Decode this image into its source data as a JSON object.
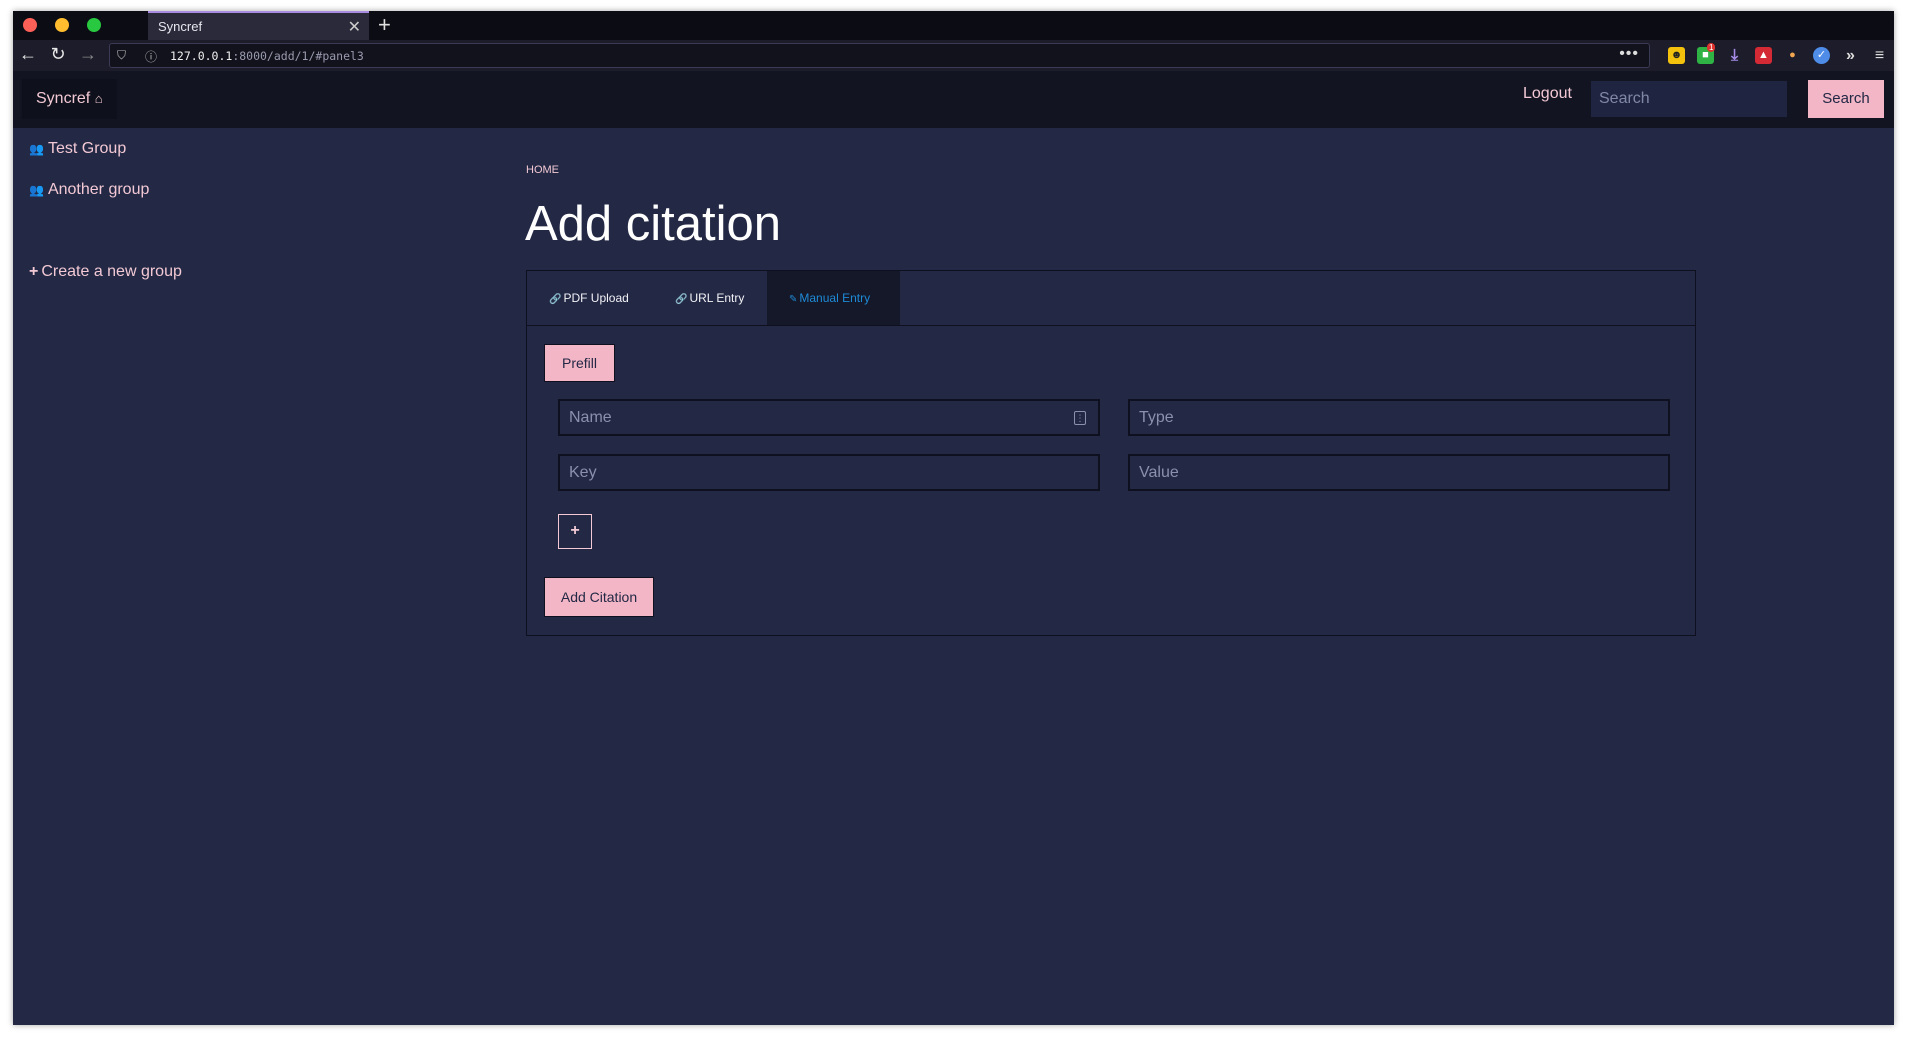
{
  "browser": {
    "tab_title": "Syncref",
    "url_host": "127.0.0.1",
    "url_path": ":8000/add/1/#panel3",
    "ext_badge": "1"
  },
  "header": {
    "brand": "Syncref",
    "logout": "Logout",
    "search_placeholder": "Search",
    "search_button": "Search"
  },
  "sidebar": {
    "groups": [
      "Test Group",
      "Another group"
    ],
    "create": "Create a new group"
  },
  "main": {
    "breadcrumb": "HOME",
    "title": "Add citation",
    "tabs": [
      "PDF Upload",
      "URL Entry",
      "Manual Entry"
    ],
    "active_tab": "Manual Entry",
    "prefill_button": "Prefill",
    "name_placeholder": "Name",
    "type_placeholder": "Type",
    "key_placeholder": "Key",
    "value_placeholder": "Value",
    "add_field_button": "+",
    "submit_button": "Add Citation"
  },
  "colors": {
    "background": "#232845",
    "accent_pink": "#f2b6c6",
    "active_tab_text": "#1e8ad6"
  }
}
